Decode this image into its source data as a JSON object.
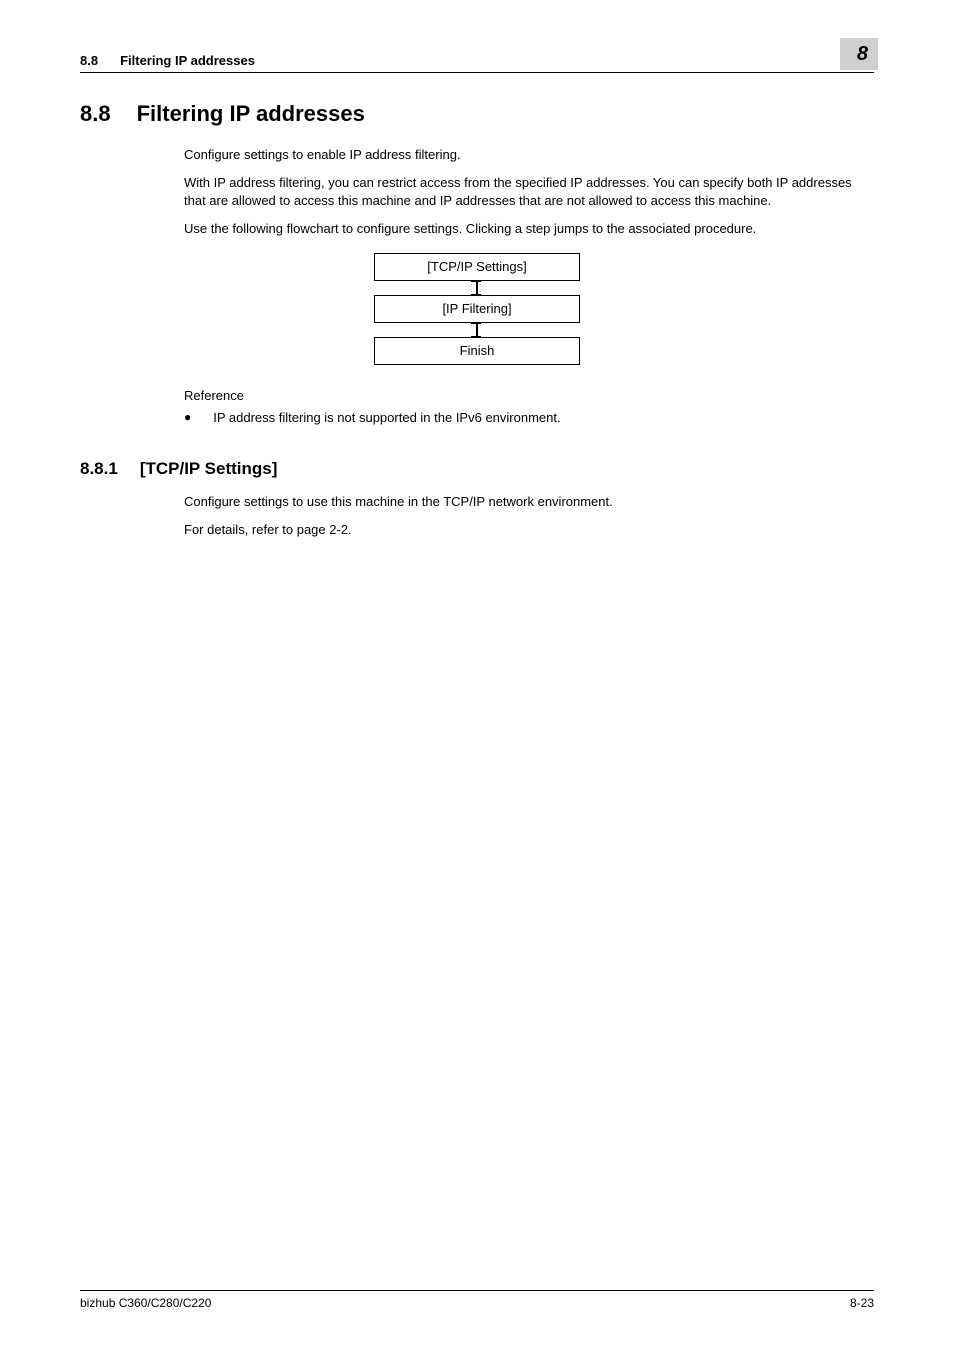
{
  "header": {
    "section_num": "8.8",
    "section_title_short": "Filtering IP addresses",
    "chapter_num": "8"
  },
  "main": {
    "section_num": "8.8",
    "section_title": "Filtering IP addresses",
    "p1": "Configure settings to enable IP address filtering.",
    "p2": "With IP address filtering, you can restrict access from the specified IP addresses. You can specify both IP addresses that are allowed to access this machine and IP addresses that are not allowed to access this machine.",
    "p3": "Use the following flowchart to configure settings. Clicking a step jumps to the associated procedure.",
    "flowchart": {
      "step1": "[TCP/IP Settings]",
      "step2": "[IP Filtering]",
      "step3": "Finish"
    },
    "reference_label": "Reference",
    "bullet1": "IP address filtering is not supported in the IPv6 environment."
  },
  "subsection": {
    "num": "8.8.1",
    "title": "[TCP/IP Settings]",
    "p1": "Configure settings to use this machine in the TCP/IP network environment.",
    "p2": "For details, refer to page 2-2."
  },
  "footer": {
    "left": "bizhub C360/C280/C220",
    "right": "8-23"
  }
}
